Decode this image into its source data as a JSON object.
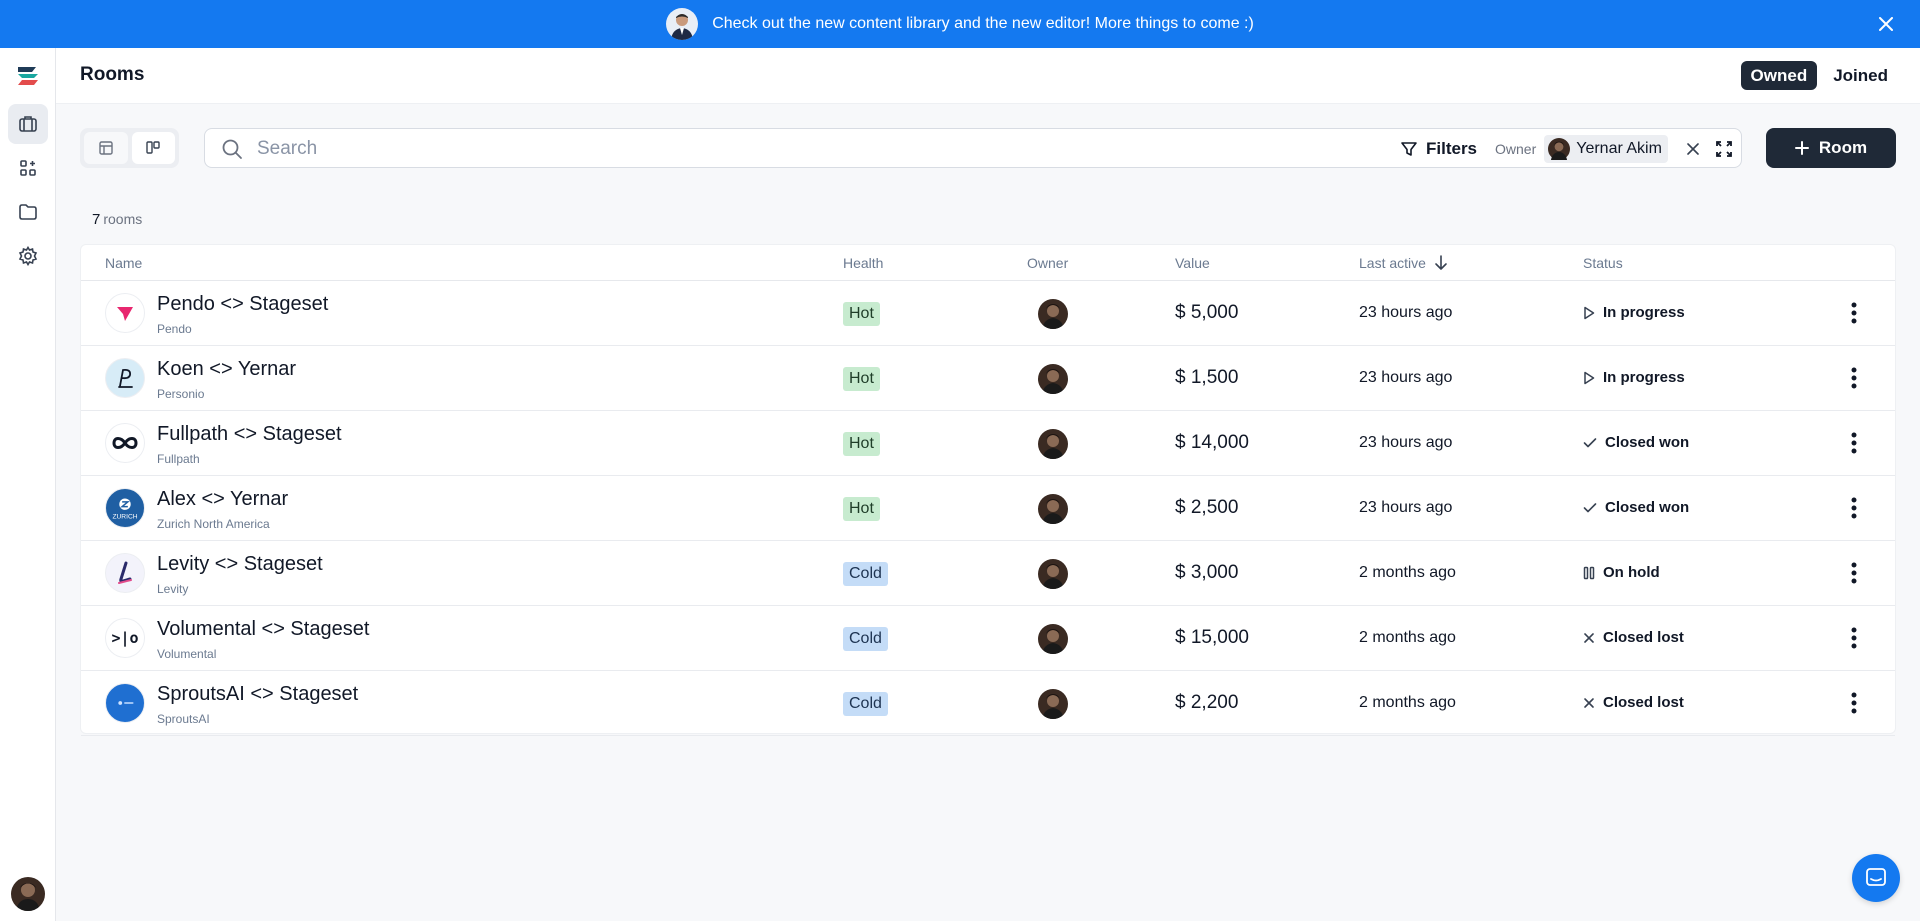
{
  "banner": {
    "message": "Check out the new content library and the new editor! More things to come :)",
    "close_icon": "close-icon",
    "color": "#1479f0"
  },
  "sidebar": {
    "items": [
      {
        "name": "rooms",
        "icon": "briefcase-icon",
        "active": true
      },
      {
        "name": "templates",
        "icon": "grid-plus-icon",
        "active": false
      },
      {
        "name": "library",
        "icon": "folder-icon",
        "active": false
      },
      {
        "name": "settings",
        "icon": "gear-icon",
        "active": false
      }
    ]
  },
  "header": {
    "title": "Rooms",
    "segments": [
      {
        "label": "Owned",
        "active": true
      },
      {
        "label": "Joined",
        "active": false
      }
    ]
  },
  "toolbar": {
    "search_placeholder": "Search",
    "filters_label": "Filters",
    "owner_label": "Owner",
    "owner_name": "Yernar Akim",
    "room_button_label": "Room"
  },
  "summary": {
    "count": "7",
    "unit": "rooms"
  },
  "table": {
    "columns": [
      "Name",
      "Health",
      "Owner",
      "Value",
      "Last active",
      "Status"
    ],
    "rows": [
      {
        "name": "Pendo <> Stageset",
        "company": "Pendo",
        "health": "Hot",
        "value": "$ 5,000",
        "last_active": "23 hours ago",
        "status": "In progress",
        "status_icon": "play-icon",
        "logo": "pendo"
      },
      {
        "name": "Koen <> Yernar",
        "company": "Personio",
        "health": "Hot",
        "value": "$ 1,500",
        "last_active": "23 hours ago",
        "status": "In progress",
        "status_icon": "play-icon",
        "logo": "personio"
      },
      {
        "name": "Fullpath <> Stageset",
        "company": "Fullpath",
        "health": "Hot",
        "value": "$ 14,000",
        "last_active": "23 hours ago",
        "status": "Closed won",
        "status_icon": "check-icon",
        "logo": "fullpath"
      },
      {
        "name": "Alex <> Yernar",
        "company": "Zurich North America",
        "health": "Hot",
        "value": "$ 2,500",
        "last_active": "23 hours ago",
        "status": "Closed won",
        "status_icon": "check-icon",
        "logo": "zurich"
      },
      {
        "name": "Levity <> Stageset",
        "company": "Levity",
        "health": "Cold",
        "value": "$ 3,000",
        "last_active": "2 months ago",
        "status": "On hold",
        "status_icon": "pause-icon",
        "logo": "levity"
      },
      {
        "name": "Volumental <> Stageset",
        "company": "Volumental",
        "health": "Cold",
        "value": "$ 15,000",
        "last_active": "2 months ago",
        "status": "Closed lost",
        "status_icon": "x-icon",
        "logo": "volumental"
      },
      {
        "name": "SproutsAI <> Stageset",
        "company": "SproutsAI",
        "health": "Cold",
        "value": "$ 2,200",
        "last_active": "2 months ago",
        "status": "Closed lost",
        "status_icon": "x-icon",
        "logo": "sprouts"
      }
    ]
  },
  "logo_texts": {
    "zurich": "ZURICH",
    "volumental": ">|o"
  },
  "colors": {
    "accent": "#1479f0",
    "dark": "#1f2937",
    "hot_bg": "#c7ebcf",
    "cold_bg": "#c4dcf7",
    "pendo": "#e8276f"
  }
}
